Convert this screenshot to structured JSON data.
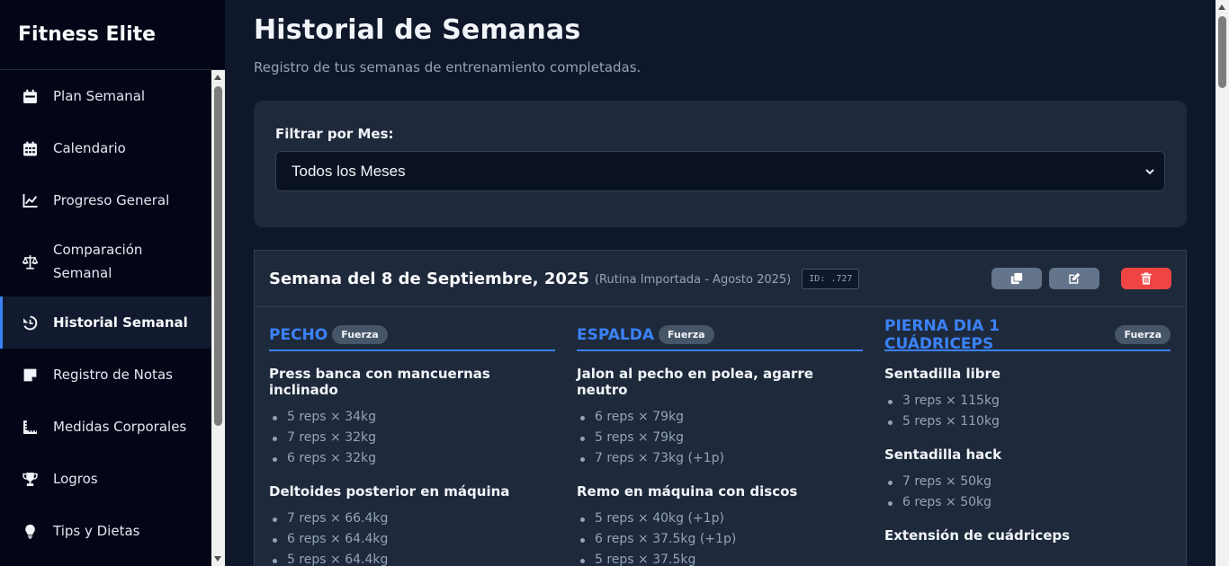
{
  "app": {
    "title": "Fitness Elite"
  },
  "sidebar": {
    "items": [
      {
        "label": "Plan Semanal",
        "icon": "calendar-day-icon"
      },
      {
        "label": "Calendario",
        "icon": "calendar-days-icon"
      },
      {
        "label": "Progreso General",
        "icon": "chart-line-icon"
      },
      {
        "label": "Comparación Semanal",
        "icon": "scale-balanced-icon"
      },
      {
        "label": "Historial Semanal",
        "icon": "history-icon",
        "active": true
      },
      {
        "label": "Registro de Notas",
        "icon": "sticky-note-icon"
      },
      {
        "label": "Medidas Corporales",
        "icon": "ruler-icon"
      },
      {
        "label": "Logros",
        "icon": "trophy-icon"
      },
      {
        "label": "Tips y Dietas",
        "icon": "lightbulb-icon"
      }
    ]
  },
  "page": {
    "title": "Historial de Semanas",
    "subtitle": "Registro de tus semanas de entrenamiento completadas."
  },
  "filter": {
    "label": "Filtrar por Mes:",
    "selected": "Todos los Meses"
  },
  "week": {
    "title": "Semana del 8 de Septiembre, 2025",
    "subtitle": "(Rutina Importada - Agosto 2025)",
    "id": "ID: .727",
    "groups": [
      {
        "name": "PECHO",
        "badge": "Fuerza",
        "exercises": [
          {
            "name": "Press banca con mancuernas inclinado",
            "sets": [
              "5 reps × 34kg",
              "7 reps × 32kg",
              "6 reps × 32kg"
            ]
          },
          {
            "name": "Deltoides posterior en máquina",
            "sets": [
              "7 reps × 66.4kg",
              "6 reps × 64.4kg",
              "5 reps × 64.4kg"
            ]
          }
        ]
      },
      {
        "name": "ESPALDA",
        "badge": "Fuerza",
        "exercises": [
          {
            "name": "Jalon al pecho en polea, agarre neutro",
            "sets": [
              "6 reps × 79kg",
              "5 reps × 79kg",
              "7 reps × 73kg (+1p)"
            ]
          },
          {
            "name": "Remo en máquina con discos",
            "sets": [
              "5 reps × 40kg (+1p)",
              "6 reps × 37.5kg (+1p)",
              "5 reps × 37.5kg"
            ]
          }
        ]
      },
      {
        "name": "PIERNA DIA 1 CUÁDRICEPS",
        "badge": "Fuerza",
        "exercises": [
          {
            "name": "Sentadilla libre",
            "sets": [
              "3 reps × 115kg",
              "5 reps × 110kg"
            ]
          },
          {
            "name": "Sentadilla hack",
            "sets": [
              "7 reps × 50kg",
              "6 reps × 50kg"
            ]
          },
          {
            "name": "Extensión de cuádriceps",
            "sets": []
          }
        ]
      }
    ]
  },
  "colors": {
    "accent": "#3b82f6",
    "danger": "#ef4444",
    "background": "#0f172a",
    "card": "#1e293b"
  }
}
